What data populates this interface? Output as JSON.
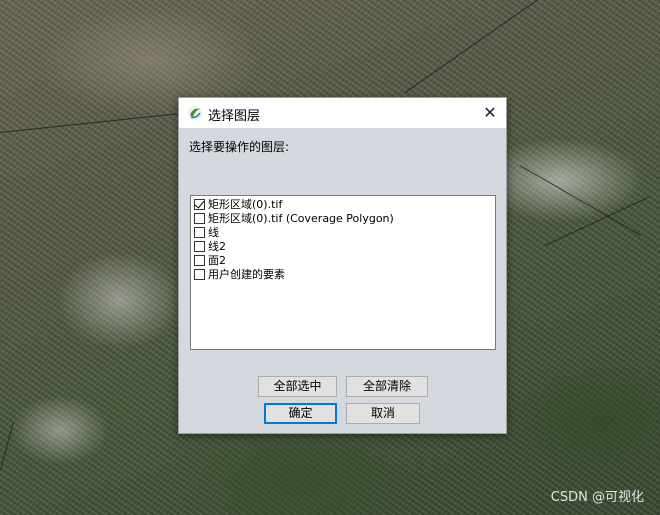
{
  "dialog": {
    "title": "选择图层",
    "close_glyph": "✕",
    "prompt": "选择要操作的图层:",
    "layers": [
      {
        "label": "矩形区域(0).tif",
        "checked": true
      },
      {
        "label": "矩形区域(0).tif (Coverage Polygon)",
        "checked": false
      },
      {
        "label": "线",
        "checked": false
      },
      {
        "label": "线2",
        "checked": false
      },
      {
        "label": "面2",
        "checked": false
      },
      {
        "label": "用户创建的要素",
        "checked": false
      }
    ],
    "buttons": {
      "select_all": "全部选中",
      "clear_all": "全部清除",
      "ok": "确定",
      "cancel": "取消"
    },
    "icons": {
      "app": "app-globe-icon",
      "close": "close-icon"
    },
    "colors": {
      "client_bg": "#d4d8df",
      "default_button_border": "#0078d7"
    }
  },
  "watermark": "CSDN @可视化"
}
